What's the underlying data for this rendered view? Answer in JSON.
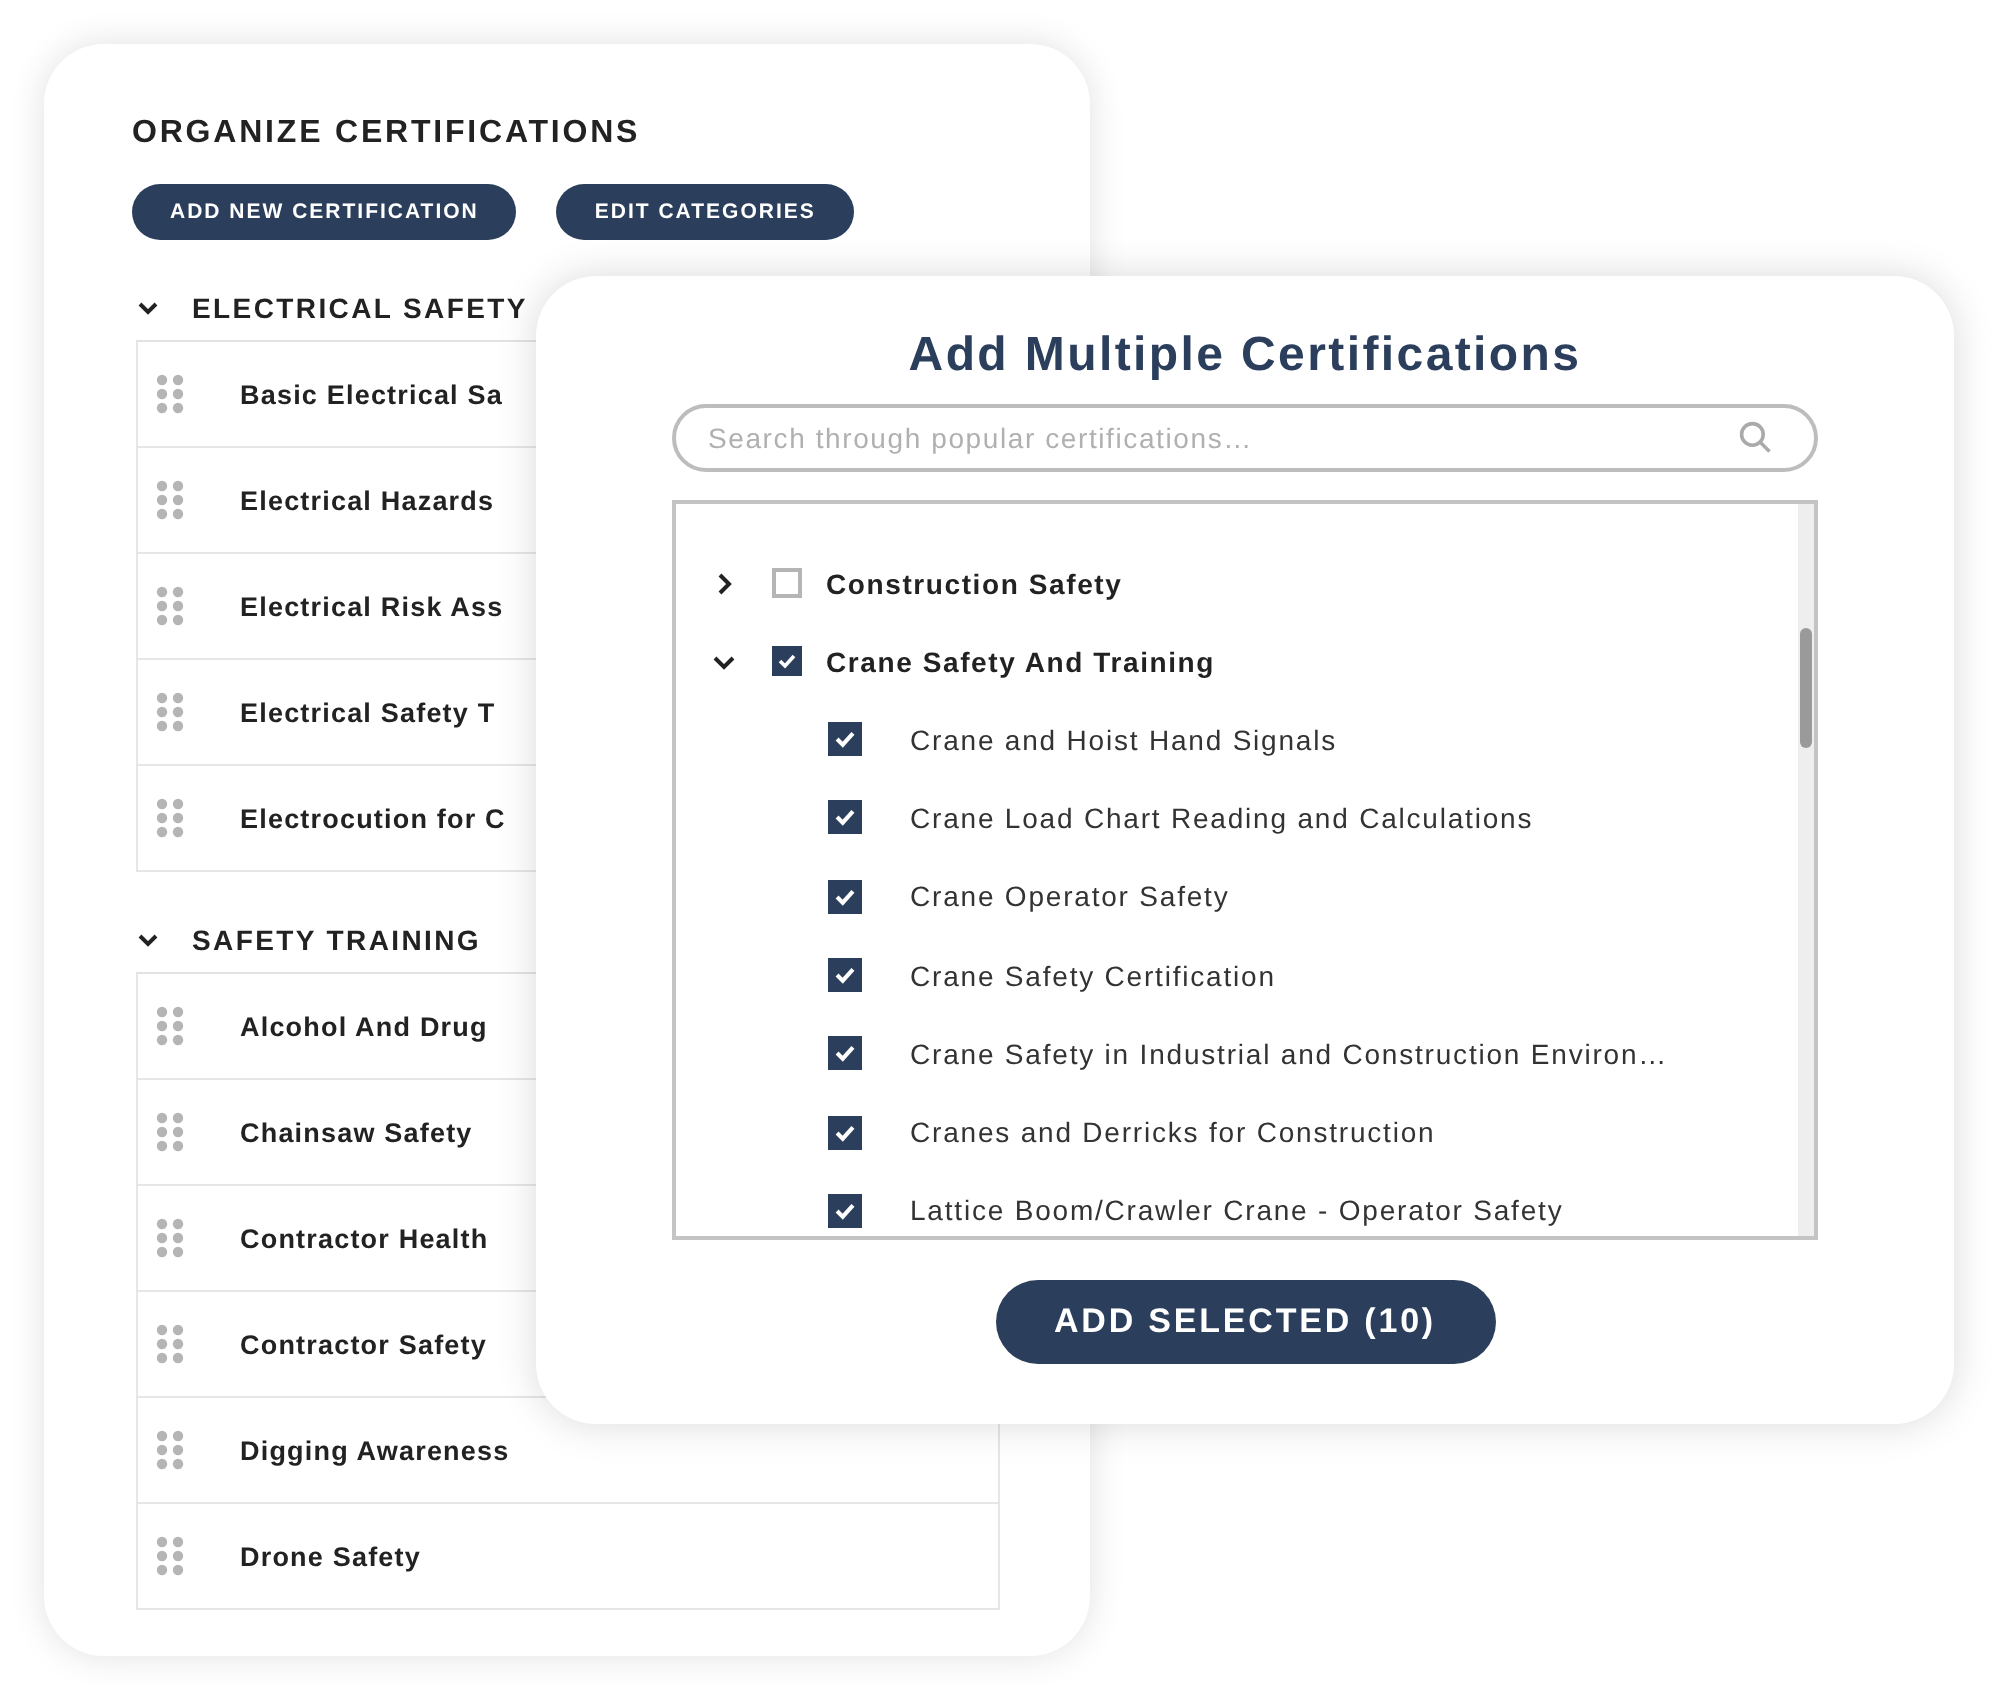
{
  "panel": {
    "title": "ORGANIZE CERTIFICATIONS",
    "buttons": [
      "ADD NEW CERTIFICATION",
      "EDIT CATEGORIES"
    ],
    "sections": [
      {
        "title": "ELECTRICAL SAFETY",
        "expanded": true,
        "items": [
          "Basic Electrical Sa",
          "Electrical Hazards",
          "Electrical Risk Ass",
          "Electrical Safety T",
          "Electrocution for C"
        ]
      },
      {
        "title": "SAFETY TRAINING",
        "expanded": true,
        "items": [
          "Alcohol And Drug",
          "Chainsaw Safety",
          "Contractor Health",
          "Contractor Safety",
          "Digging Awareness",
          "Drone Safety"
        ]
      }
    ]
  },
  "dialog": {
    "title": "Add Multiple Certifications",
    "search": {
      "placeholder": "Search through popular certifications…"
    },
    "categories": [
      {
        "name": "Construction Safety",
        "expanded": false,
        "checked": false
      },
      {
        "name": "Crane Safety And Training",
        "expanded": true,
        "checked": true,
        "children": [
          {
            "name": "Crane and Hoist Hand Signals",
            "checked": true
          },
          {
            "name": "Crane Load Chart Reading and Calculations",
            "checked": true
          },
          {
            "name": "Crane Operator Safety",
            "checked": true
          },
          {
            "name": "Crane Safety Certification",
            "checked": true
          },
          {
            "name": "Crane Safety in Industrial and Construction Environ…",
            "checked": true
          },
          {
            "name": "Cranes and Derricks for Construction",
            "checked": true
          },
          {
            "name": "Lattice Boom/Crawler Crane - Operator Safety",
            "checked": true
          }
        ]
      }
    ],
    "button": "ADD SELECTED (10)"
  }
}
